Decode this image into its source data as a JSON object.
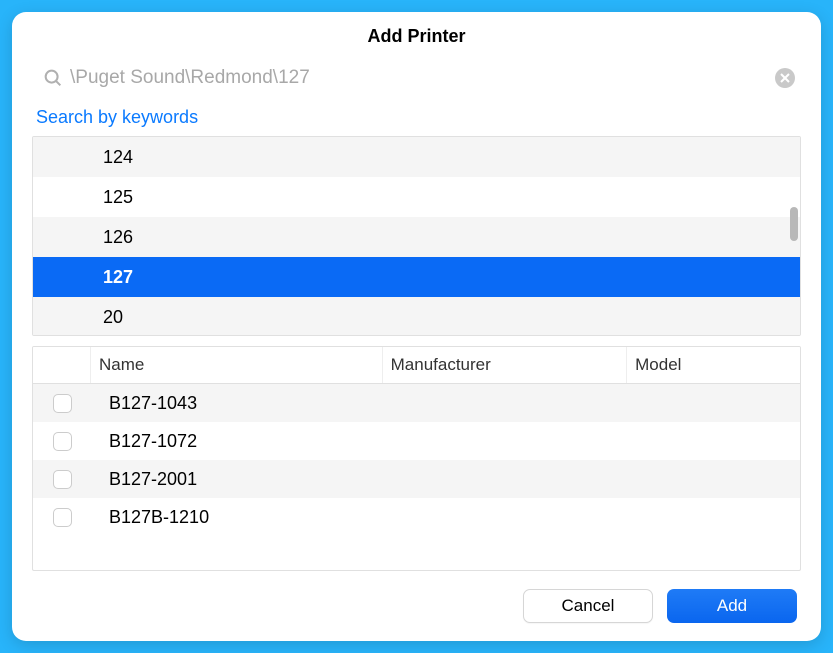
{
  "dialog": {
    "title": "Add Printer"
  },
  "search": {
    "placeholder": "\\Puget Sound\\Redmond\\127",
    "keywords_link": "Search by keywords"
  },
  "locations": [
    {
      "label": "124",
      "selected": false
    },
    {
      "label": "125",
      "selected": false
    },
    {
      "label": "126",
      "selected": false
    },
    {
      "label": "127",
      "selected": true
    },
    {
      "label": "20",
      "selected": false
    }
  ],
  "table": {
    "headers": {
      "name": "Name",
      "manufacturer": "Manufacturer",
      "model": "Model"
    },
    "rows": [
      {
        "name": "B127-1043",
        "manufacturer": "",
        "model": ""
      },
      {
        "name": "B127-1072",
        "manufacturer": "",
        "model": ""
      },
      {
        "name": "B127-2001",
        "manufacturer": "",
        "model": ""
      },
      {
        "name": "B127B-1210",
        "manufacturer": "",
        "model": ""
      }
    ]
  },
  "buttons": {
    "cancel": "Cancel",
    "add": "Add"
  }
}
